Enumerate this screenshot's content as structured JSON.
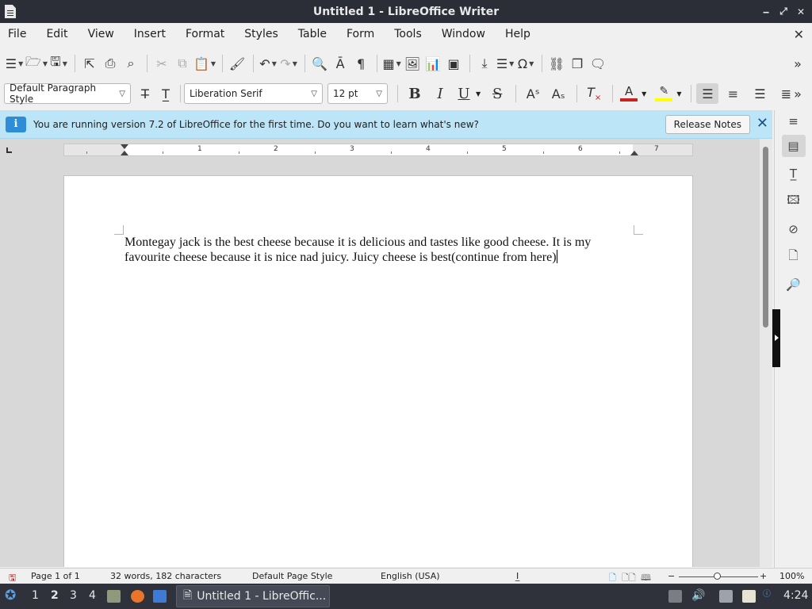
{
  "window": {
    "title": "Untitled 1 - LibreOffice Writer",
    "controls": [
      "‒",
      "⤢",
      "✕"
    ]
  },
  "menu": [
    "File",
    "Edit",
    "View",
    "Insert",
    "Format",
    "Styles",
    "Table",
    "Form",
    "Tools",
    "Window",
    "Help"
  ],
  "formatting": {
    "paragraph_style": "Default Paragraph Style",
    "font_name": "Liberation Serif",
    "font_size": "12 pt",
    "bold": "B",
    "italic": "I",
    "underline": "U",
    "strike": "S"
  },
  "infobar": {
    "icon": "i",
    "message": "You are running version 7.2 of LibreOffice for the first time. Do you want to learn what's new?",
    "button": "Release Notes"
  },
  "ruler_numbers": [
    "1",
    "2",
    "3",
    "4",
    "5",
    "6",
    "7"
  ],
  "document": {
    "text": "Montegay jack is the best cheese because it is delicious and tastes like good cheese. It is my favourite cheese because it is nice nad juicy. Juicy cheese is best(continue from here)"
  },
  "status": {
    "page": "Page 1 of 1",
    "words": "32 words, 182 characters",
    "page_style": "Default Page Style",
    "language": "English (USA)",
    "zoom": "100%"
  },
  "taskbar": {
    "workspaces": [
      "1",
      "2",
      "3",
      "4"
    ],
    "active_workspace": "2",
    "app_label": "Untitled 1 - LibreOffic...",
    "clock": "4:24"
  },
  "colors": {
    "font_color": "#c9211e",
    "highlight": "#ffff00",
    "accent": "#2e8dd6"
  }
}
